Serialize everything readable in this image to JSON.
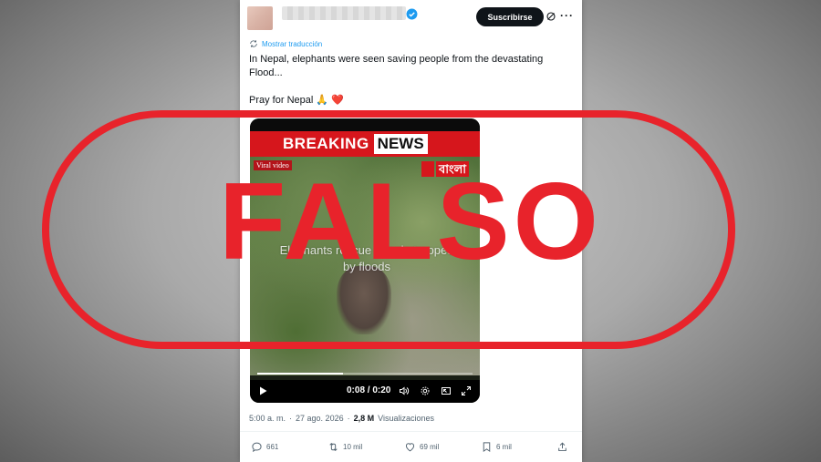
{
  "header": {
    "subscribe_label": "Suscribirse"
  },
  "tweet": {
    "translate_label": "Mostrar traducción",
    "line1": "In Nepal, elephants were seen saving people from the devastating Flood...",
    "line2": "Pray for Nepal 🙏 ❤️"
  },
  "video": {
    "breaking_label": "BREAKING",
    "news_label": "NEWS",
    "viral_label": "Viral video",
    "channel_label": "বাংলা",
    "overlay_text": "Elephants rescue people trapped by floods",
    "time_label": "0:08 / 0:20",
    "progress": 0.4
  },
  "meta": {
    "time": "5:00 a. m.",
    "dot": "·",
    "date": "27 ago. 2026",
    "views_count": "2,8 M",
    "views_label": "Visualizaciones"
  },
  "actions": {
    "replies": "661",
    "reposts": "10 mil",
    "likes": "69 mil",
    "bookmarks": "6 mil"
  },
  "stamp": {
    "label": "FALSO",
    "color": "#e8232b"
  },
  "colors": {
    "accent": "#1d9bf0",
    "text": "#0f1419",
    "muted": "#536471",
    "news_red": "#d6161c"
  }
}
